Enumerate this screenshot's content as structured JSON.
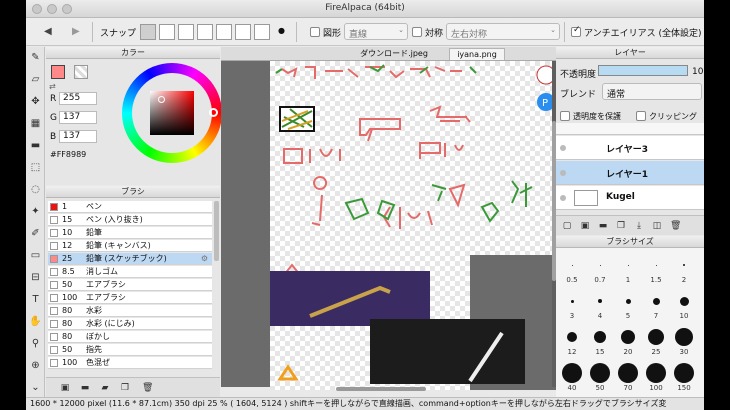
{
  "window": {
    "title": "FireAlpaca (64bit)"
  },
  "toolbar": {
    "snap_label": "スナップ",
    "shape_label": "図形",
    "shape_value": "直線",
    "symmetry_label": "対称",
    "symmetry_value": "左右対称",
    "antialias_label": "アンチエイリアス (全体設定)",
    "shape_checked": false,
    "symmetry_checked": false,
    "antialias_checked": true
  },
  "color_panel": {
    "title": "カラー",
    "r_label": "R",
    "r_value": "255",
    "g_label": "G",
    "g_value": "137",
    "b_label": "B",
    "b_value": "137",
    "hex": "#FF8989",
    "primary_color": "#ff8989",
    "secondary_color": "#cccccc",
    "hue_color": "#ff0000"
  },
  "brush_panel": {
    "title": "ブラシ",
    "items": [
      {
        "size": "1",
        "name": "ペン",
        "color": "#e11",
        "selected": false
      },
      {
        "size": "15",
        "name": "ペン (入り抜き)",
        "color": "#fff",
        "selected": false
      },
      {
        "size": "10",
        "name": "鉛筆",
        "color": "#fff",
        "selected": false
      },
      {
        "size": "12",
        "name": "鉛筆 (キャンバス)",
        "color": "#fff",
        "selected": false
      },
      {
        "size": "25",
        "name": "鉛筆 (スケッチブック)",
        "color": "#ff8989",
        "selected": true
      },
      {
        "size": "8.5",
        "name": "消しゴム",
        "color": "#fff",
        "selected": false
      },
      {
        "size": "50",
        "name": "エアブラシ",
        "color": "#fff",
        "selected": false
      },
      {
        "size": "100",
        "name": "エアブラシ",
        "color": "#fff",
        "selected": false
      },
      {
        "size": "80",
        "name": "水彩",
        "color": "#fff",
        "selected": false
      },
      {
        "size": "80",
        "name": "水彩 (にじみ)",
        "color": "#fff",
        "selected": false
      },
      {
        "size": "80",
        "name": "ぼかし",
        "color": "#fff",
        "selected": false
      },
      {
        "size": "50",
        "name": "指先",
        "color": "#fff",
        "selected": false
      },
      {
        "size": "100",
        "name": "色混ぜ",
        "color": "#fff",
        "selected": false
      }
    ]
  },
  "canvas": {
    "tabs": [
      "ダウンロード.jpeg",
      "iyana.png"
    ],
    "active_tab": 1
  },
  "layer_panel": {
    "title": "レイヤー",
    "opacity_label": "不透明度",
    "opacity_value": "10",
    "blend_label": "ブレンド",
    "blend_value": "通常",
    "protect_label": "透明度を保護",
    "clipping_label": "クリッピング",
    "layers": [
      {
        "name": "レイヤー3",
        "selected": false
      },
      {
        "name": "レイヤー1",
        "selected": true
      },
      {
        "name": "Kugel",
        "selected": false
      }
    ]
  },
  "size_panel": {
    "title": "ブラシサイズ",
    "sizes": [
      "0.5",
      "0.7",
      "1",
      "1.5",
      "2",
      "3",
      "4",
      "5",
      "7",
      "10",
      "12",
      "15",
      "20",
      "25",
      "30",
      "40",
      "50",
      "70",
      "100",
      "150"
    ]
  },
  "status": {
    "text": "1600 * 12000 pixel  (11.6 * 87.1cm)   350 dpi   25 %  ( 1604, 5124 )   shiftキーを押しながらで直線描画、command+optionキーを押しながら左右ドラッグでブラシサイズ変"
  }
}
